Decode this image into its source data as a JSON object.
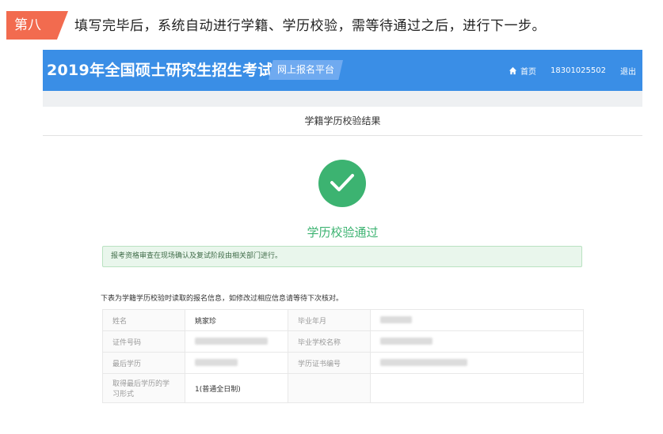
{
  "step": {
    "tag": "第八",
    "text": "填写完毕后，系统自动进行学籍、学历校验，需等待通过之后，进行下一步。"
  },
  "header": {
    "title": "2019年全国硕士研究生招生考试",
    "platform": "网上报名平台",
    "nav": {
      "home": "首页",
      "user": "18301025502",
      "logout": "退出"
    }
  },
  "page": {
    "title": "学籍学历校验结果",
    "status": "学历校验通过",
    "notice": "报考资格审查在现场确认及复试阶段由相关部门进行。",
    "intro": "下表为学籍学历校验时读取的报名信息，如修改过相应信息请等待下次核对。"
  },
  "table": {
    "rows": [
      {
        "label1": "姓名",
        "value1": "姚家珍",
        "label2": "毕业年月",
        "value2": ""
      },
      {
        "label1": "证件号码",
        "value1": "",
        "label2": "毕业学校名称",
        "value2": ""
      },
      {
        "label1": "最后学历",
        "value1": "",
        "label2": "学历证书编号",
        "value2": ""
      },
      {
        "label1": "取得最后学历的学习形式",
        "value1": "1(普通全日制)",
        "label2": "",
        "value2": ""
      }
    ]
  },
  "colors": {
    "accent": "#3a8ee6",
    "success": "#3cb371",
    "step_tag": "#f26b4f"
  }
}
